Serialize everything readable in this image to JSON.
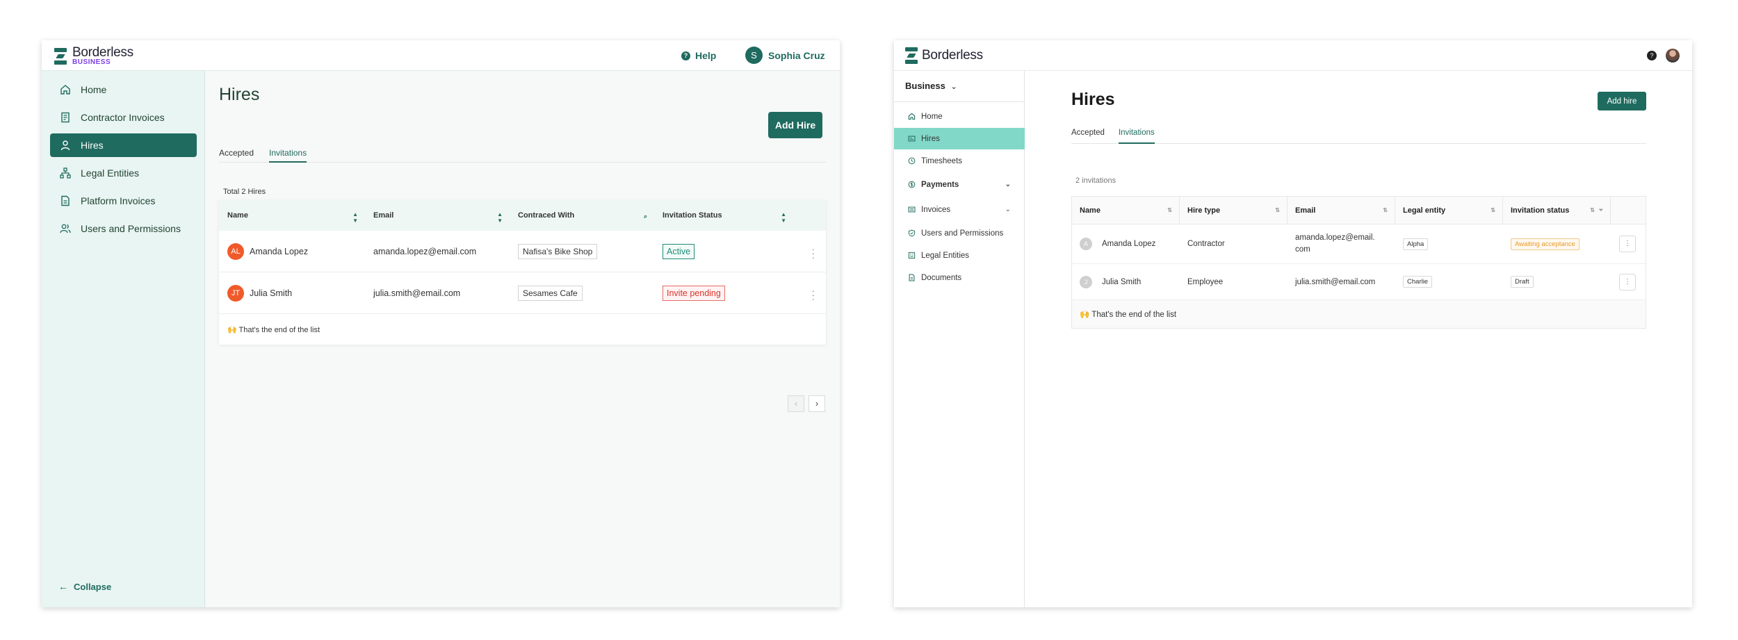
{
  "left": {
    "logo": {
      "name": "Borderless",
      "sub": "BUSINESS"
    },
    "header": {
      "help": "Help",
      "user_initial": "S",
      "user_name": "Sophia Cruz"
    },
    "sidebar": {
      "items": [
        {
          "label": "Home",
          "icon": "home-icon"
        },
        {
          "label": "Contractor Invoices",
          "icon": "invoice-icon"
        },
        {
          "label": "Hires",
          "icon": "user-icon",
          "active": true
        },
        {
          "label": "Legal Entities",
          "icon": "org-chart-icon"
        },
        {
          "label": "Platform Invoices",
          "icon": "document-icon"
        },
        {
          "label": "Users and Permissions",
          "icon": "users-icon"
        }
      ],
      "collapse": "Collapse"
    },
    "main": {
      "title": "Hires",
      "add_button": "Add Hire",
      "tabs": [
        "Accepted",
        "Invitations"
      ],
      "active_tab": "Invitations",
      "total": "Total 2 Hires",
      "columns": [
        "Name",
        "Email",
        "Contraced With",
        "Invitation Status"
      ],
      "rows": [
        {
          "initials": "AL",
          "name": "Amanda Lopez",
          "email": "amanda.lopez@email.com",
          "contracted": "Nafisa's Bike Shop",
          "status": "Active"
        },
        {
          "initials": "JT",
          "name": "Julia Smith",
          "email": "julia.smith@email.com",
          "contracted": "Sesames Cafe",
          "status": "Invite pending"
        }
      ],
      "end_text": "🙌 That's the end of the list"
    }
  },
  "right": {
    "logo": {
      "name": "Borderless"
    },
    "header": {
      "help": "?"
    },
    "sidebar": {
      "business": "Business",
      "items": [
        {
          "label": "Home",
          "icon": "home-icon"
        },
        {
          "label": "Hires",
          "icon": "id-card-icon",
          "active": true
        },
        {
          "label": "Timesheets",
          "icon": "clock-icon"
        },
        {
          "label": "Payments",
          "icon": "dollar-icon",
          "expandable": true
        },
        {
          "label": "Invoices",
          "icon": "invoice-icon",
          "expandable": true
        },
        {
          "label": "Users and Permissions",
          "icon": "shield-icon"
        },
        {
          "label": "Legal Entities",
          "icon": "building-icon"
        },
        {
          "label": "Documents",
          "icon": "document-icon"
        }
      ]
    },
    "main": {
      "title": "Hires",
      "add_button": "Add hire",
      "tabs": [
        "Accepted",
        "Invitations"
      ],
      "active_tab": "Invitations",
      "count": "2 invitations",
      "columns": [
        "Name",
        "Hire type",
        "Email",
        "Legal entity",
        "Invitation status"
      ],
      "rows": [
        {
          "initial": "A",
          "name": "Amanda Lopez",
          "type": "Contractor",
          "email_l1": "amanda.lopez@email.",
          "email_l2": "com",
          "entity": "Alpha",
          "status": "Awaiting acceptance"
        },
        {
          "initial": "J",
          "name": "Julia Smith",
          "type": "Employee",
          "email_l1": "julia.smith@email.com",
          "email_l2": "",
          "entity": "Charlie",
          "status": "Draft"
        }
      ],
      "end_text": "🙌 That's the end of the list"
    }
  },
  "colors": {
    "brand": "#1f6b5f",
    "active_side": "#82d8c8",
    "danger": "#d9322b",
    "avatar": "#f05a2a"
  }
}
